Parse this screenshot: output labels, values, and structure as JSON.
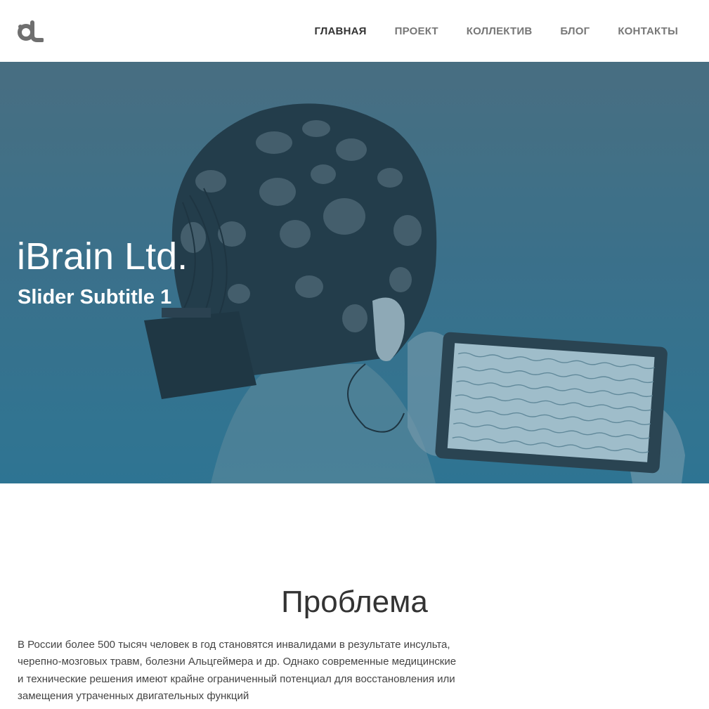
{
  "nav": {
    "items": [
      {
        "label": "ГЛАВНАЯ",
        "active": true
      },
      {
        "label": "ПРОЕКТ",
        "active": false
      },
      {
        "label": "КОЛЛЕКТИВ",
        "active": false
      },
      {
        "label": "БЛОГ",
        "active": false
      },
      {
        "label": "КОНТАКТЫ",
        "active": false
      }
    ]
  },
  "logo": {
    "icon": "ibrain-logo-icon",
    "color": "#6f6f6f"
  },
  "hero": {
    "title": "iBrain Ltd.",
    "subtitle": "Slider Subtitle 1",
    "overlay_color": "#2f7593"
  },
  "problem": {
    "title": "Проблема",
    "text": "В России более 500 тысяч человек в год становятся инвалидами в результате инсульта, черепно-мозговых травм, болезни Альцгеймера и др. Однако современные медицинские и технические решения имеют крайне ограниченный потенциал для восстановления или замещения утраченных двигательных функций"
  }
}
